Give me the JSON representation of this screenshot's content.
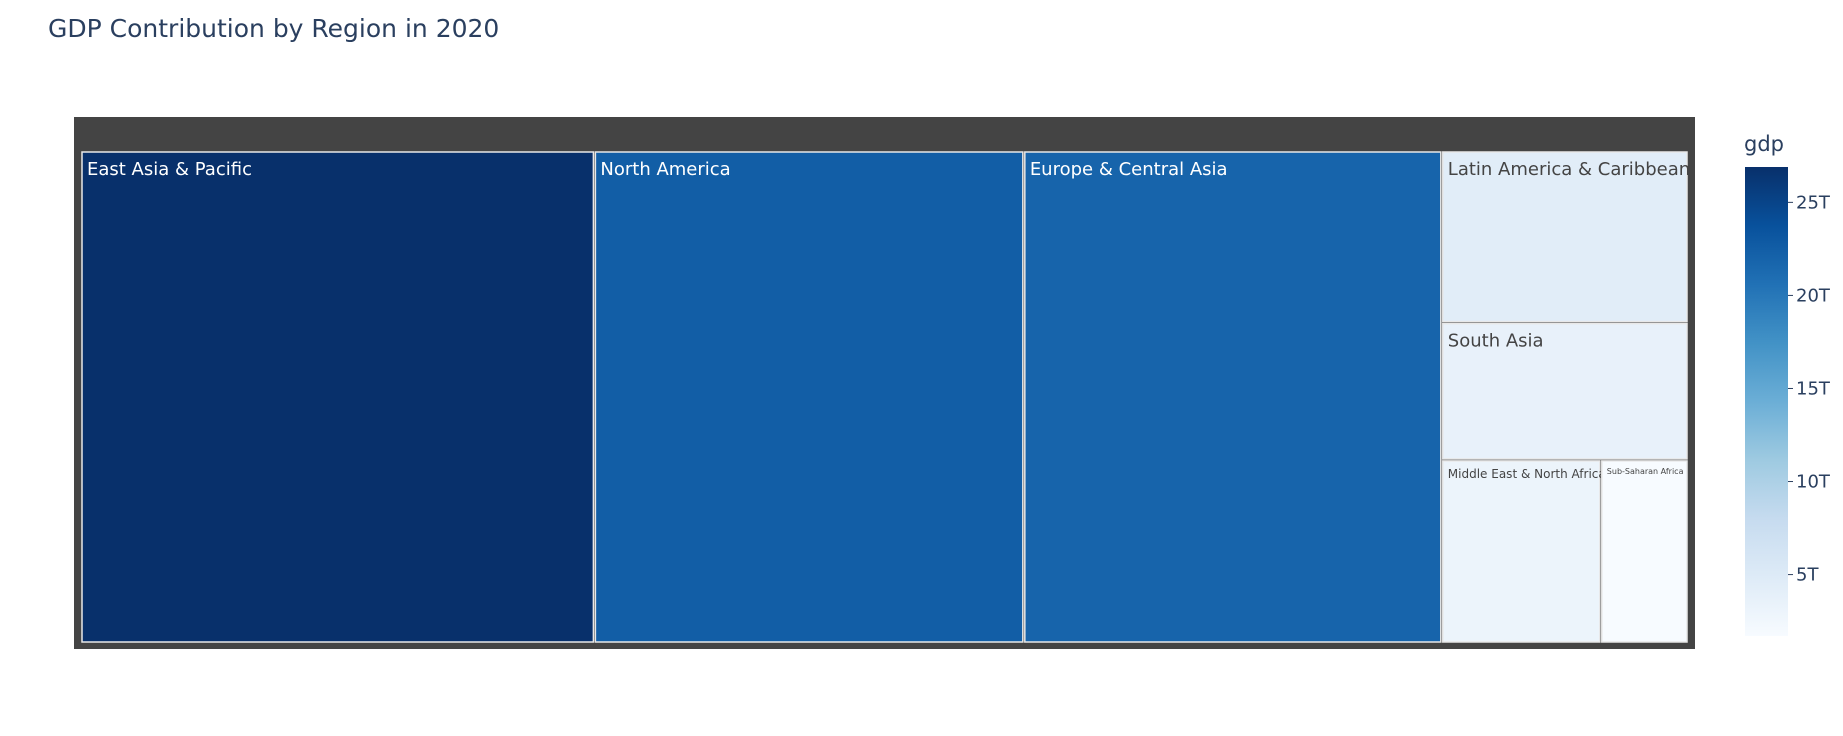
{
  "chart_data": {
    "type": "treemap",
    "title": "GDP Contribution by Region in 2020",
    "root_label": "",
    "regions": [
      {
        "label": "East Asia & Pacific",
        "value": 26.9
      },
      {
        "label": "North America",
        "value": 22.5
      },
      {
        "label": "Europe & Central Asia",
        "value": 21.9
      },
      {
        "label": "Latin America & Caribbean",
        "value": 4.5
      },
      {
        "label": "South Asia",
        "value": 3.6
      },
      {
        "label": "Middle East & North Africa",
        "value": 3.1
      },
      {
        "label": "Sub-Saharan Africa",
        "value": 1.7
      }
    ],
    "colorbar": {
      "title": "gdp",
      "colorscale": "Blues",
      "range": [
        1.7,
        26.9
      ],
      "ticks": [
        5,
        10,
        15,
        20,
        25
      ],
      "tick_labels": [
        "5T",
        "10T",
        "15T",
        "20T",
        "25T"
      ]
    },
    "colors": {
      "background": "#ffffff",
      "root_fill": "#444444",
      "title_color": "#2a3f5f",
      "tick_color": "#2a3f5f",
      "cell_border": "#e8e8e8"
    }
  }
}
